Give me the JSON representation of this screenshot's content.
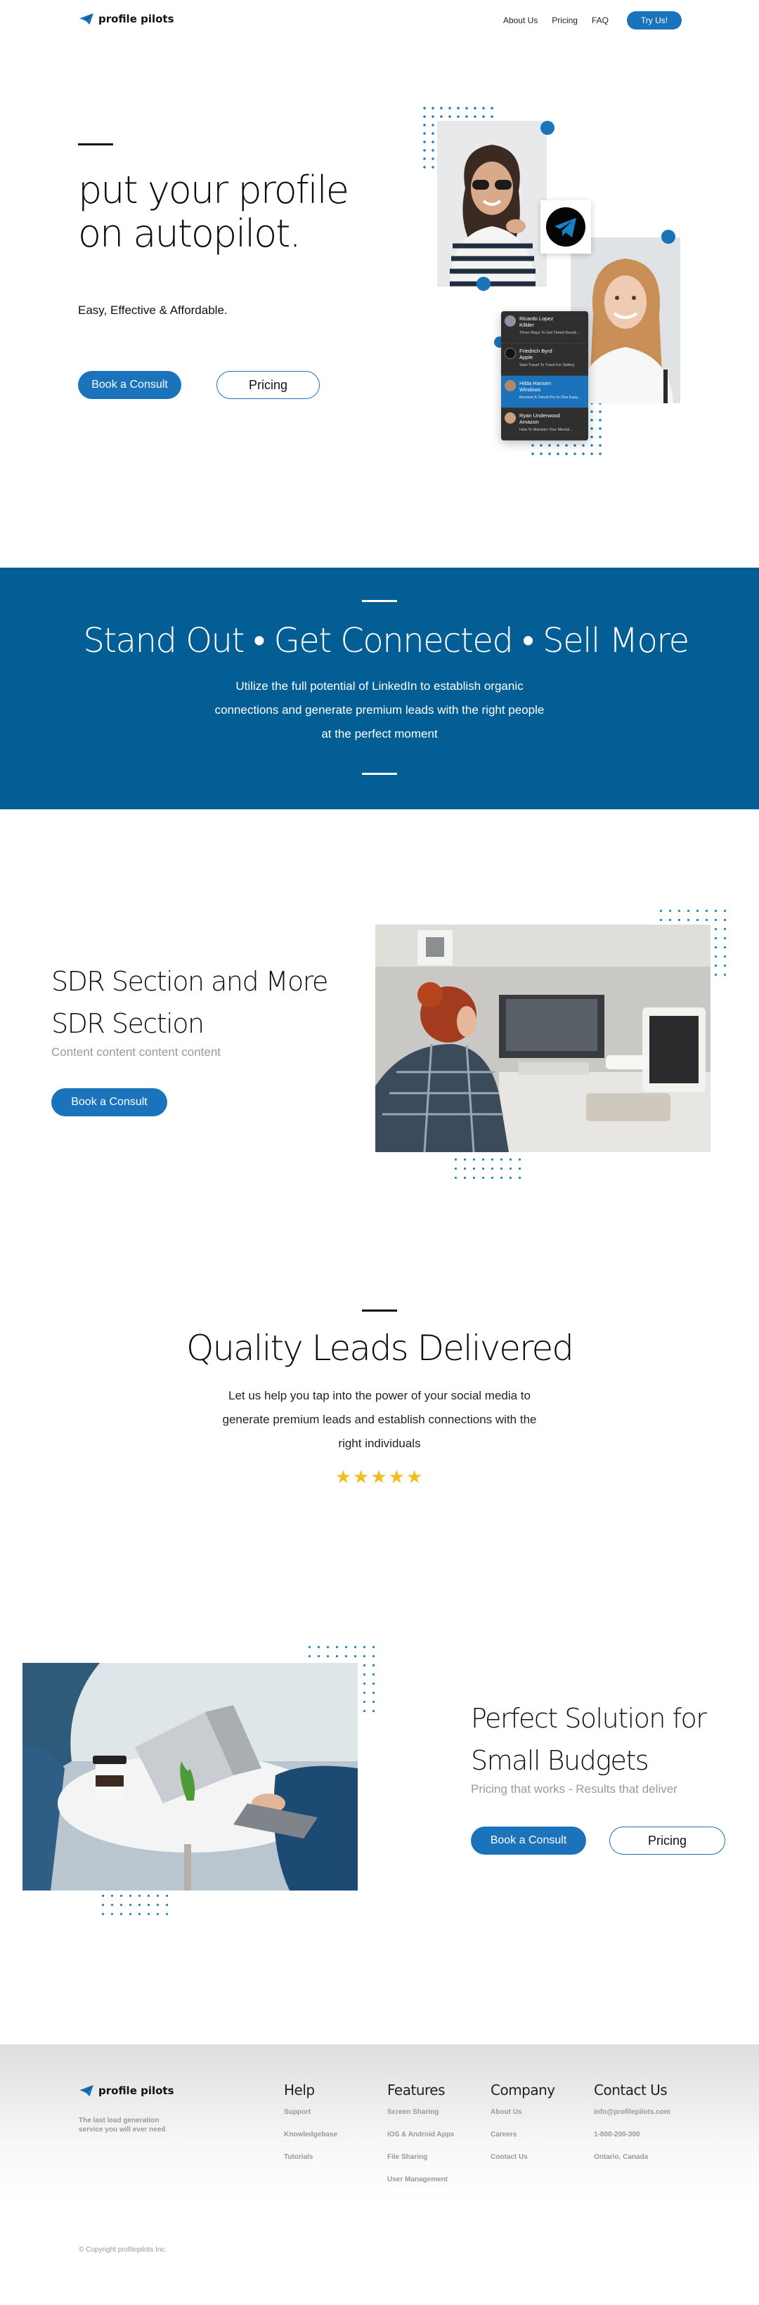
{
  "brand": {
    "name": "profile pilots",
    "accent": "#1a73bb",
    "band_color": "#035e96",
    "star_color": "#f2bd1d"
  },
  "nav": {
    "links": [
      "About Us",
      "Pricing",
      "FAQ"
    ],
    "cta": "Try Us!"
  },
  "hero": {
    "title": "put your profile on autopilot.",
    "subtitle": "Easy, Effective & Affordable.",
    "primary_button": "Book a Consult",
    "secondary_button": "Pricing",
    "chat": [
      {
        "name": "Ricardo Lopez",
        "title": "Killder",
        "message": "Three Ways To Get Timed Result..."
      },
      {
        "name": "Friedrich Byrd",
        "title": "Apple",
        "message": "Start Travel To Track For Sallery"
      },
      {
        "name": "Hilda Hansen",
        "title": "Windows",
        "message": "Become A Travel Pro In One Easy..."
      },
      {
        "name": "Ryan Underwood",
        "title": "Amazon",
        "message": "How To Maintain Your Mental..."
      }
    ]
  },
  "band": {
    "title": "Stand Out • Get Connected • Sell More",
    "text": "Utilize the full potential of LinkedIn to establish organic connections and generate premium leads with the right people at the perfect moment"
  },
  "sdr": {
    "title": "SDR Section and More SDR Section",
    "subtitle": "Content content content content",
    "button": "Book a Consult"
  },
  "quality": {
    "title": "Quality Leads Delivered",
    "text": "Let us help you tap into the power of your social media to generate premium leads and establish connections with the right individuals",
    "stars": "★★★★★",
    "rating": 5
  },
  "budget": {
    "title": "Perfect Solution for Small Budgets",
    "subtitle": "Pricing that works - Results that deliver",
    "primary_button": "Book a Consult",
    "secondary_button": "Pricing"
  },
  "footer": {
    "tagline": "The last lead generation service you will ever need",
    "columns": [
      {
        "title": "Help",
        "items": [
          "Support",
          "Knowledgebase",
          "Tutorials"
        ]
      },
      {
        "title": "Features",
        "items": [
          "Screen Sharing",
          "iOS & Android Apps",
          "File Sharing",
          "User Management"
        ]
      },
      {
        "title": "Company",
        "items": [
          "About Us",
          "Careers",
          "Contact Us"
        ]
      },
      {
        "title": "Contact Us",
        "items": [
          "info@profilepilots.com",
          "1-800-200-300",
          "Ontario, Canada"
        ]
      }
    ],
    "copyright": "© Copyright profilepilots Inc."
  }
}
